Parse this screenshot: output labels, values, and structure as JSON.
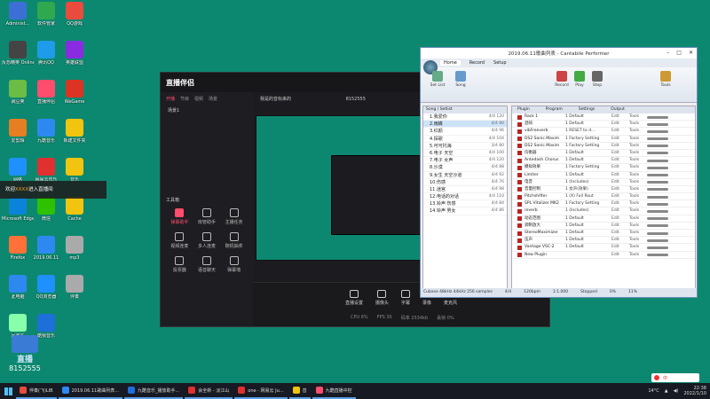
{
  "desktop": {
    "icons": [
      {
        "label": "Administ...",
        "color": "#3b6fd6"
      },
      {
        "label": "软件管家",
        "color": "#2fa84f"
      },
      {
        "label": "QQ游戏",
        "color": "#e94b3c"
      },
      {
        "label": "反恐精英 Online",
        "color": "#444"
      },
      {
        "label": "腾讯QQ",
        "color": "#1e9be9"
      },
      {
        "label": "英雄联盟",
        "color": "#8a2be2"
      },
      {
        "label": "豌豆荚",
        "color": "#6cbd45"
      },
      {
        "label": "直播伴侣",
        "color": "#ff4d6d"
      },
      {
        "label": "WeGame",
        "color": "#d32"
      },
      {
        "label": "爱剪辑",
        "color": "#e67e22"
      },
      {
        "label": "九酷音乐",
        "color": "#2d89ef"
      },
      {
        "label": "新建文件夹",
        "color": "#f1c40f"
      },
      {
        "label": "网络",
        "color": "#1e90ff"
      },
      {
        "label": "网易云音乐",
        "color": "#e03030"
      },
      {
        "label": "音乐",
        "color": "#f1c40f"
      },
      {
        "label": "Microsoft Edge",
        "color": "#0a84d8"
      },
      {
        "label": "微信",
        "color": "#2dc100"
      },
      {
        "label": "Cache",
        "color": "#f1c40f"
      },
      {
        "label": "Firefox",
        "color": "#ff7139"
      },
      {
        "label": "2019.06.11",
        "color": "#2d89ef"
      },
      {
        "label": "mp3",
        "color": "#aaa"
      },
      {
        "label": "此电脑",
        "color": "#2d89ef"
      },
      {
        "label": "QQ浏览器",
        "color": "#1e90ff"
      },
      {
        "label": "伴奏",
        "color": "#aaa"
      },
      {
        "label": "回收站",
        "color": "#8fa"
      },
      {
        "label": "酷我音乐",
        "color": "#1e6fd9"
      }
    ]
  },
  "banner": {
    "prefix": "欢迎",
    "highlight": "XXXX",
    "suffix": "进入直播间"
  },
  "watermark": {
    "text1": "直播",
    "text2": "8152555"
  },
  "live_app": {
    "logo": "直播伴侣",
    "tabs": [
      "开播",
      "节目",
      "视频",
      "场景"
    ],
    "scene_label": "场景1",
    "topbar_text": "我是的音标来的",
    "topbar_id": "8152555",
    "tools_title": "工具箱",
    "tools": [
      {
        "label": "弹幕助手",
        "hot": true
      },
      {
        "label": "房管助手",
        "hot": false
      },
      {
        "label": "主播任务",
        "hot": false
      },
      {
        "label": "视频连麦",
        "hot": false
      },
      {
        "label": "多人连麦",
        "hot": false
      },
      {
        "label": "随机抽奖",
        "hot": false
      },
      {
        "label": "投票器",
        "hot": false
      },
      {
        "label": "语音聊天",
        "hot": false
      },
      {
        "label": "弹幕墙",
        "hot": false
      }
    ],
    "bottom_buttons": [
      "直播设置",
      "摄像头",
      "字幕",
      "录像",
      "麦克风"
    ],
    "status": [
      "CPU 6%",
      "FPS 30",
      "码率 2534kb",
      "丢帧 0%"
    ]
  },
  "cantabile": {
    "title": "2019.06.11歌曲列表 - Cantabile Performer",
    "window_controls": [
      "–",
      "□",
      "✕"
    ],
    "ribbon_tabs": [
      "Home",
      "Record",
      "Setup"
    ],
    "ribbon_buttons": [
      {
        "label": "Set List",
        "color": "#6a8"
      },
      {
        "label": "Song",
        "color": "#69c"
      },
      {
        "label": "Record",
        "color": "#c44"
      },
      {
        "label": "Play",
        "color": "#4a4"
      },
      {
        "label": "Stop",
        "color": "#666"
      },
      {
        "label": "Tools",
        "color": "#c93"
      }
    ],
    "left_head": "Song / Setlist",
    "left_items": [
      {
        "name": "1.我爱你",
        "n": "4/4 120",
        "sel": false
      },
      {
        "name": "2.雨蝶",
        "n": "4/4 90",
        "sel": true
      },
      {
        "name": "3.红颜",
        "n": "4/4 96",
        "sel": false
      },
      {
        "name": "4.探歌",
        "n": "4/4 104",
        "sel": false
      },
      {
        "name": "5.可可托海",
        "n": "3/4 80",
        "sel": false
      },
      {
        "name": "6.电子 天空",
        "n": "4/4 100",
        "sel": false
      },
      {
        "name": "7.电子 女声",
        "n": "4/4 120",
        "sel": false
      },
      {
        "name": "8.沙漠",
        "n": "4/4 88",
        "sel": false
      },
      {
        "name": "9.女生 天空沙道",
        "n": "4/4 92",
        "sel": false
      },
      {
        "name": "10.伤感",
        "n": "4/4 76",
        "sel": false
      },
      {
        "name": "11.迷宫",
        "n": "4/4 98",
        "sel": false
      },
      {
        "name": "12.电话的对话",
        "n": "4/4 110",
        "sel": false
      },
      {
        "name": "13.铃声 伤感",
        "n": "4/4 84",
        "sel": false
      },
      {
        "name": "14.铃声 男女",
        "n": "4/4 86",
        "sel": false
      }
    ],
    "right_head": [
      "Plugin",
      "Program",
      "Settings",
      "Output"
    ],
    "plugins": [
      {
        "name": "Rack 1",
        "prog": "1 Default"
      },
      {
        "name": "混响",
        "prog": "1 Default"
      },
      {
        "name": "vibFreeverb",
        "prog": "1 RESET to d..."
      },
      {
        "name": "DS2 Sonic.Maxim",
        "prog": "1 Factory Setting"
      },
      {
        "name": "DS2 Sonic.Maxim",
        "prog": "1 Factory Setting"
      },
      {
        "name": "均衡器",
        "prog": "1 Default"
      },
      {
        "name": "Antedash Chorus",
        "prog": "1 Default"
      },
      {
        "name": "模拟效果",
        "prog": "1 Factory Setting"
      },
      {
        "name": "Limiter",
        "prog": "1 Default"
      },
      {
        "name": "电音",
        "prog": "1 (Includes)"
      },
      {
        "name": "音量控制",
        "prog": "1 女声(效果)"
      },
      {
        "name": "Pitchshifter",
        "prog": "1 (X) Full Rout"
      },
      {
        "name": "SPL Vitalizer MK2",
        "prog": "1 Factory Setting"
      },
      {
        "name": "reverb",
        "prog": "1 (Includes)"
      },
      {
        "name": "动态范围",
        "prog": "1 Default"
      },
      {
        "name": "调制放大",
        "prog": "1 Default"
      },
      {
        "name": "StereoMaximizer",
        "prog": "1 Default"
      },
      {
        "name": "压声",
        "prog": "1 Default"
      },
      {
        "name": "Vantage VSC-2",
        "prog": "1 Default"
      },
      {
        "name": "New Plugin",
        "prog": ""
      }
    ],
    "statusbar": [
      "Cubase 48kHz 44kHz 256 samples",
      "4/4",
      "120bpm",
      "1:1.000",
      "Stopped",
      "0%",
      "11%"
    ]
  },
  "taskbar": {
    "items": [
      {
        "label": "伴奏(飞)LIB",
        "color": "#e74c3c"
      },
      {
        "label": "2019.06.11歌曲列表...",
        "color": "#2d89ef"
      },
      {
        "label": "九酷音乐_播放助手...",
        "color": "#1e6fd9"
      },
      {
        "label": "会全新 - 淡江山",
        "color": "#e03030"
      },
      {
        "label": "one - 网易云 Ju...",
        "color": "#e03030"
      },
      {
        "label": "音",
        "color": "#f1c40f"
      },
      {
        "label": "九酷直播中控",
        "color": "#ff4d6d"
      }
    ],
    "temp": "14°C",
    "time": "22:38",
    "date": "2022/1/10",
    "ime": "中"
  }
}
